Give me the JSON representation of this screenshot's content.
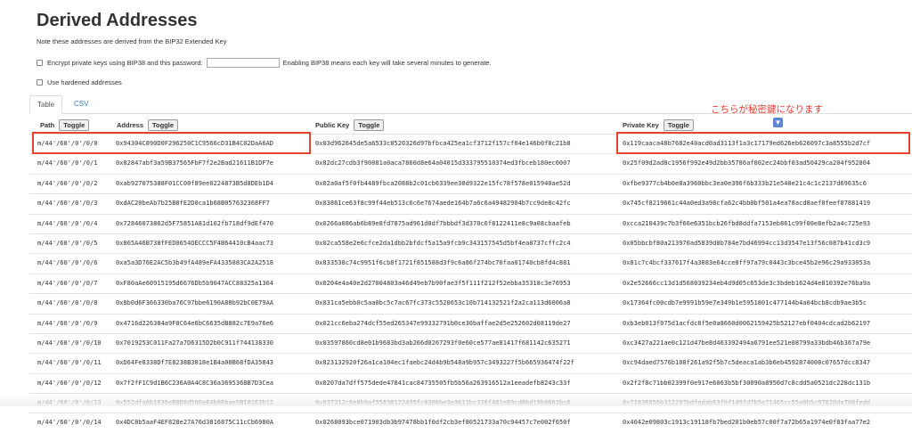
{
  "title": "Derived Addresses",
  "note": "Note these addresses are derived from the BIP32 Extended Key",
  "encrypt": {
    "label": "Encrypt private keys using BIP38 and this password:",
    "password_value": "",
    "hint": "Enabling BIP38 means each key will take several minutes to generate."
  },
  "hardened": {
    "label": "Use hardened addresses"
  },
  "tabs": [
    "Table",
    "CSV"
  ],
  "columns": {
    "path": "Path",
    "address": "Address",
    "public_key": "Public Key",
    "private_key": "Private Key",
    "toggle": "Toggle"
  },
  "annotation": "こちらが秘密鍵になります",
  "highlight_color": "#e8432f",
  "rows": [
    {
      "path": "m/44'/60'/0'/0/0",
      "address": "0x94304C890D0F296250C1C9566cD31B4C02DaA6AD",
      "public_key": "0x03d962645de5a6533c8520326d97bfbca425ea1cf3712f157cf04e146b0f8c21b8",
      "private_key": "0x119caaca48b7682e40acd0ad3113f1a3c17179ed626eb626097c3a8555b2d7cf"
    },
    {
      "path": "m/44'/60'/0'/0/1",
      "address": "0x02847abf3a59B37565FbF7f2e2Bad21611B1DF7e",
      "public_key": "0x02dc27cdb3f90081a0aca7860d8e64a04015d333795510374ed3fbceb180ec6007",
      "private_key": "0x25f09d2ad8c1956f992e49d2bb35786af002ec24bbf03ad50429ca204f952804"
    },
    {
      "path": "m/44'/60'/0'/0/2",
      "address": "0xab927075388F01CC00f89ee0224873B5d8DEb1D4",
      "public_key": "0x02a0af5f0fb4489fbca2088b2c01cb6339ee30d9322e15fc78f578e015940ae52d",
      "private_key": "0xfbe9377cb4b0e8a3960bbc3ea0e396f6b333b21e540e21c4c1c2137d69635c6"
    },
    {
      "path": "m/44'/60'/0'/0/3",
      "address": "0xdAC20beAb7b25B8fE2D0ca1b68B057632368FF7",
      "public_key": "0x03861ce63f8c99f44eb513c6c6e7674aede164b7a6c6a49482904b7cc9de8c42fc",
      "private_key": "0x745cf8219661c44a0ed3a98cfa62c4bb0bf501a4ea78acd8aef0feef87881419"
    },
    {
      "path": "m/44'/60'/0'/0/4",
      "address": "0x72846073862d5F75851A81d102fb718df9dEf470",
      "public_key": "0x0266a086ab6b89e8fd7875ad961d8df7bbbdf3d370c6f8122411e8c9a08cbaafeb",
      "private_key": "0xcca210439c7b3f66e6351bcb26fbd8ddfa7153eb861c99f00e8efb2a4c725e93"
    },
    {
      "path": "m/44'/60'/0'/0/5",
      "address": "0x865A46B738fFED0654OECCC5F4B64410cB4aac73",
      "public_key": "0x02ca558e2e6cfce2da1dbb2bfdcf5a15a9fcb9c343157545d5bf4ea8737cffc2c4",
      "private_key": "0x05bbcbf80a213970ad5839d8b784e7bd46994cc13d3547e13f56c087b41cd3c9"
    },
    {
      "path": "m/44'/60'/0'/0/6",
      "address": "0xa5a3D76E2AC5b3b49fA489eFA4335883CA2A2518",
      "public_key": "0x033538c74c9951f6cb8f1721f851588d3f9c6a86f274bc70faa01740cb8fd4c881",
      "private_key": "0x81c7c4bcf337617f4a3083e64cce8ff97a79c0443c3bce45b2e96c29a933053a"
    },
    {
      "path": "m/44'/60'/0'/0/7",
      "address": "0xF80aAe60915195d6676Db5b9047ACC88325a1364",
      "public_key": "0x0204e4a40e2d27004803a46d49eb7b90fae3f5f111f212f52ebba35318c3e76953",
      "private_key": "0x2e52666cc13d1d568039234eb4d9d05c653de3c3bdeb1624d4e810392e76ba9a"
    },
    {
      "path": "m/44'/60'/0'/0/8",
      "address": "0x8b0d6F366330ba76C97bbe6190A88b92bC0E79AA",
      "public_key": "0x031ca5ebb0c5aa0bc5c7ac67fc373c5520653c10b714132521f2a2ca113d6006a8",
      "private_key": "0x17364fc00cdb7e9991b59e7e349b1e5951801c477144b4a04bcb8cdb9ae3b5c"
    },
    {
      "path": "m/44'/60'/0'/0/9",
      "address": "0x4716d226384a9F0C64e6bC6635dB882c7E9a76e6",
      "public_key": "0x021cc6eba274dcf55ed265347e99332791b0ce30baffae2d5e252602d08119de27",
      "private_key": "0xb3eb013f075d1acfdc8f5e0a8660d0062159425b52127ebf0404cdcad2b62197"
    },
    {
      "path": "m/44'/60'/0'/0/10",
      "address": "0x7019253C011Fa27a7D6315D2b0C911f744138330",
      "public_key": "0x03597860cd8e01b9683bd3ab266d0267293f0e60ce577ae81417f681142c635271",
      "private_key": "0xc3427a221ae0c121d47be8d463392494a6791ee521e08799a33bdb46b367a79e"
    },
    {
      "path": "m/44'/60'/0'/0/11",
      "address": "0xD64Fe8338Df7E8238B3018e1B4a08B68fDA35843",
      "public_key": "0x023132920f26a1ca104ec1faebc24d4b9b548a9b957c3493227f5b665936474f22f",
      "private_key": "0xc94daed7576b108f261a92f5b7c5deaca1ab3b6eb4592874008c07657dcc8347"
    },
    {
      "path": "m/44'/60'/0'/0/12",
      "address": "0x7f2fF1C9d1B6C236A0A4C8C36a3695368B7D3Cea",
      "public_key": "0x0207da7dff575dede47841cac84735505fb5b56a263916512a1eeadefb8243c33f",
      "private_key": "0x2f2f8c71bb02399f0e917e6063b5bf30090a8950d7c8cdd5a0521dc228dc131b"
    },
    {
      "path": "m/44'/60'/0'/0/13",
      "address": "0x552dfa6b1636eB8D8d50EeE4b0Ebae5B181E2b12",
      "public_key": "0x037212c6e8b9af55830122495fc8306be3e3611bc326f481e89cd8bd19b9661bc6",
      "private_key": "0x71836856b312297bdfedab63f9f1497d7b5e71465cc55a0b5c97620da708fedd"
    },
    {
      "path": "m/44'/60'/0'/0/14",
      "address": "0x4DC8b5aaF4EF828e27A76d3816875C11cCb6980A",
      "public_key": "0x0268093bce071903db3b97478bb1f0df2cb3ef80521733a70c94457c7e002f650f",
      "private_key": "0x4042e09803c1913c19118fb7bed201b0eb57c00f7a72b65a1974e0f83faa77e2"
    }
  ]
}
